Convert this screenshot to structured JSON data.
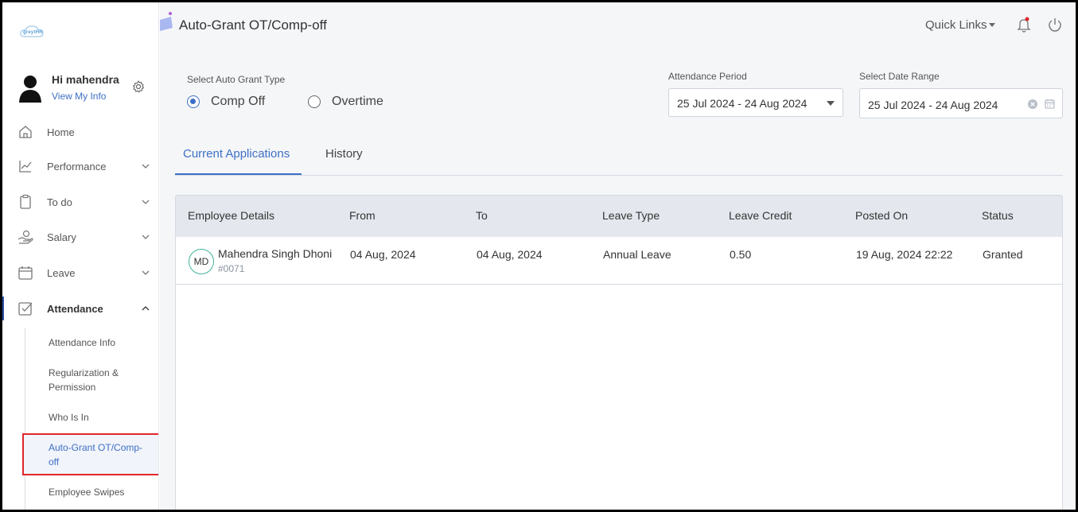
{
  "app": {
    "logo_text": "greytHR"
  },
  "user": {
    "greeting": "Hi mahendra",
    "view_info": "View My Info"
  },
  "sidebar": {
    "items": [
      {
        "label": "Home",
        "icon": "home-icon",
        "expandable": false
      },
      {
        "label": "Performance",
        "icon": "chart-line-icon",
        "expandable": true
      },
      {
        "label": "To do",
        "icon": "clipboard-icon",
        "expandable": true
      },
      {
        "label": "Salary",
        "icon": "hand-coin-icon",
        "expandable": true
      },
      {
        "label": "Leave",
        "icon": "calendar-icon",
        "expandable": true
      },
      {
        "label": "Attendance",
        "icon": "checkbox-icon",
        "expandable": true,
        "expanded": true
      }
    ],
    "attendance_sub": [
      {
        "label": "Attendance Info"
      },
      {
        "label": "Regularization & Permission"
      },
      {
        "label": "Who Is In"
      },
      {
        "label": "Auto-Grant OT/Comp-off",
        "selected": true
      },
      {
        "label": "Employee Swipes"
      }
    ]
  },
  "header": {
    "title": "Auto-Grant OT/Comp-off",
    "quick_links": "Quick Links"
  },
  "filters": {
    "grant_type_label": "Select Auto Grant Type",
    "options": [
      {
        "label": "Comp Off",
        "checked": true
      },
      {
        "label": "Overtime",
        "checked": false
      }
    ],
    "attendance_period_label": "Attendance Period",
    "attendance_period_value": "25 Jul 2024 - 24 Aug 2024",
    "date_range_label": "Select Date Range",
    "date_range_value": "25 Jul 2024 - 24 Aug 2024"
  },
  "tabs": [
    {
      "label": "Current Applications",
      "active": true
    },
    {
      "label": "History",
      "active": false
    }
  ],
  "table": {
    "columns": [
      "Employee Details",
      "From",
      "To",
      "Leave Type",
      "Leave Credit",
      "Posted On",
      "Status"
    ],
    "rows": [
      {
        "initials": "MD",
        "name": "Mahendra Singh Dhoni",
        "emp_id": "#0071",
        "from": "04 Aug, 2024",
        "to": "04 Aug, 2024",
        "leave_type": "Annual Leave",
        "leave_credit": "0.50",
        "posted_on": "19 Aug, 2024 22:22",
        "status": "Granted"
      }
    ]
  },
  "colors": {
    "accent": "#3d6fc4",
    "highlight": "#e0262b",
    "notification_dot": "#e0262b"
  }
}
